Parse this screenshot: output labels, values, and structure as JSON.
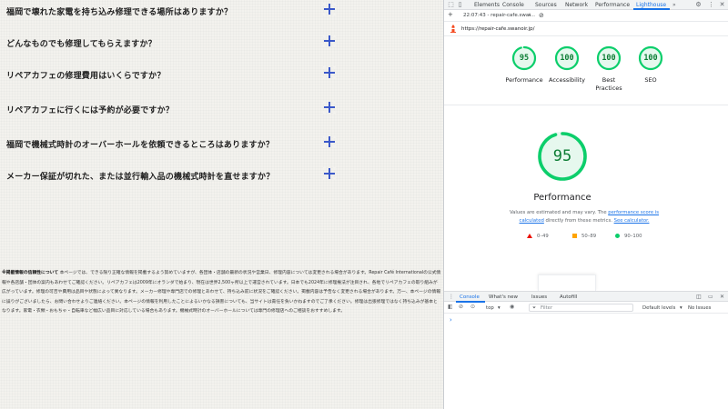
{
  "page": {
    "faqs": [
      "福岡で壊れた家電を持ち込み修理できる場所はありますか？",
      "どんなものでも修理してもらえますか？",
      "リペアカフェの修理費用はいくらですか？",
      "リペアカフェに行くには予約が必要ですか？",
      "福岡で機械式時計のオーバーホールを依頼できるところはありますか？",
      "メーカー保証が切れた、または並行輸入品の機械式時計を直せますか？"
    ],
    "disclaimer_lead": "※掲載情報の信頼性について",
    "disclaimer_body": "本ページでは、できる限り正確な情報を掲載するよう努めていますが、各団体・店舗の最新の状況や営業日、修理内容については変更される場合があります。Repair Café Internationalの公式情報や各店舗・団体の案内もあわせてご確認ください。リペアカフェは2009年にオランダで始まり、現在は世界2,500ヶ所以上で運営されています。日本でも2024年に修理権法が注目され、各地でリペアカフェの取り組みが広がっています。修理の可否や費用は品目や状態によって異なります。メーカー修理や専門店での修理とあわせて、持ち込み前に状況をご確認ください。掲載内容は予告なく変更される場合があります。万一、本ページの情報に誤りがございましたら、お問い合わせよりご連絡ください。本ページの情報を利用したことによるいかなる損害についても、当サイトは責任を負いかねますのでご了承ください。修理は出張修理ではなく持ち込みが基本となります。家電・衣類・おもちゃ・自転車など幅広い品目に対応している場合もあります。機械式時計のオーバーホールについては専門の修理店へのご相談をおすすめします。"
  },
  "devtools": {
    "tabs": [
      "Elements",
      "Console",
      "Sources",
      "Network",
      "Performance",
      "Lighthouse"
    ],
    "active_tab": "Lighthouse",
    "overflow_glyph": "»",
    "report_time": "22:07:43 - repair-cafe.swai...",
    "report_add": "+",
    "report_url": "https://repair-cafe.swanoir.jp/",
    "scores": [
      {
        "value": 95,
        "label": "Performance"
      },
      {
        "value": 100,
        "label": "Accessibility"
      },
      {
        "value": 100,
        "label": "Best Practices"
      },
      {
        "value": 100,
        "label": "SEO"
      }
    ],
    "main_score": 95,
    "main_title": "Performance",
    "note_prefix": "Values are estimated and may vary. The ",
    "note_link1": "performance score is calculated",
    "note_middle": " directly from these metrics. ",
    "note_link2": "See calculator.",
    "legend": [
      "0–49",
      "50–89",
      "90–100"
    ],
    "colors": {
      "good": "#0cce6b",
      "good_text": "#0c7d34",
      "average": "#ffa400",
      "fail": "#eb0f00",
      "accent": "#1a73e8"
    },
    "drawer": {
      "tabs": [
        "Console",
        "What's new",
        "Issues",
        "Autofill"
      ],
      "active": "Console",
      "context": "top",
      "filter_placeholder": "Filter",
      "levels": "Default levels",
      "issues": "No Issues",
      "prompt": "›"
    }
  }
}
